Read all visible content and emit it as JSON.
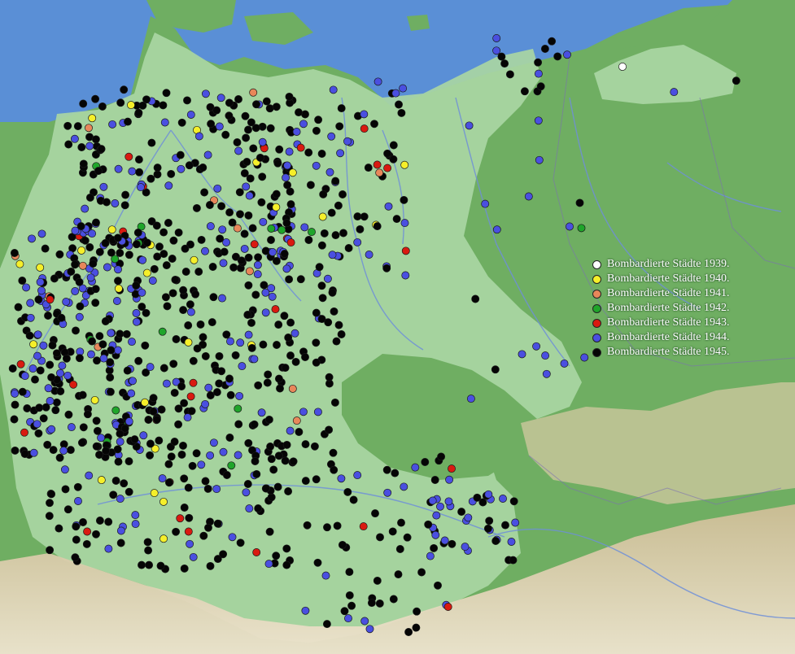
{
  "legend": {
    "items": [
      {
        "year": 1939,
        "label": "Bombardierte Städte 1939.",
        "color": "#ffffff"
      },
      {
        "year": 1940,
        "label": "Bombardierte Städte 1940.",
        "color": "#f5ef2a"
      },
      {
        "year": 1941,
        "label": "Bombardierte Städte 1941.",
        "color": "#e8875a"
      },
      {
        "year": 1942,
        "label": "Bombardierte Städte 1942.",
        "color": "#1fa52a"
      },
      {
        "year": 1943,
        "label": "Bombardierte Städte 1943.",
        "color": "#d91a10"
      },
      {
        "year": 1944,
        "label": "Bombardierte Städte 1944.",
        "color": "#4a4fe0"
      },
      {
        "year": 1945,
        "label": "Bombardierte Städte 1945.",
        "color": "#050505"
      }
    ]
  },
  "map_colors": {
    "sea": "#5a8fd6",
    "land": "#6fae62",
    "highlighted_region": "#a9d6a3",
    "mountains": "#d8c9a8",
    "rivers": "#6f8fd8",
    "borders": "#7b6fb3"
  }
}
